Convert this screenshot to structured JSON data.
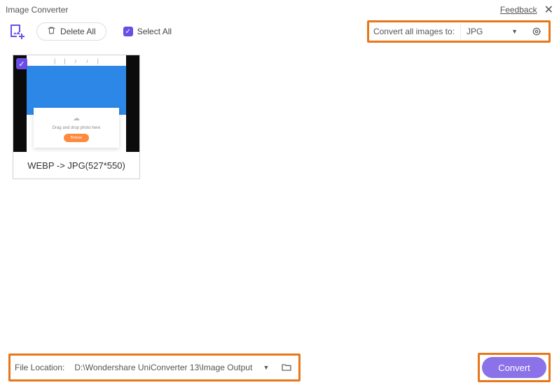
{
  "title": "Image Converter",
  "feedback": "Feedback",
  "toolbar": {
    "delete_all": "Delete All",
    "select_all": "Select All",
    "convert_label": "Convert all images to:",
    "format": "JPG"
  },
  "items": [
    {
      "caption": "WEBP -> JPG(527*550)",
      "inner_text": "Drag and drop photo here"
    }
  ],
  "footer": {
    "file_location_label": "File Location:",
    "file_location_path": "D:\\Wondershare UniConverter 13\\Image Output",
    "convert": "Convert"
  }
}
